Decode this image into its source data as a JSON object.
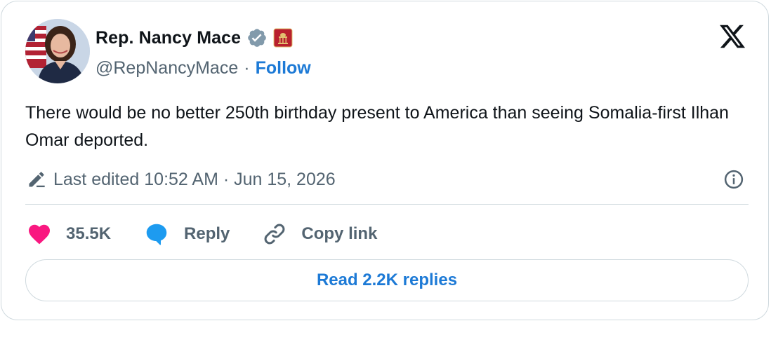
{
  "author": {
    "display_name": "Rep. Nancy Mace",
    "handle": "@RepNancyMace",
    "separator": "·",
    "follow_label": "Follow",
    "verified_badge_color": "#829aab"
  },
  "tweet": {
    "text": "There would be no better 250th birthday present to America than seeing Somalia-first Ilhan Omar deported.",
    "edited_label": "Last edited 10:52 AM · Jun 15, 2026"
  },
  "actions": {
    "like_count": "35.5K",
    "reply_label": "Reply",
    "copy_label": "Copy link",
    "read_replies_label": "Read 2.2K replies"
  },
  "colors": {
    "accent": "#1d7ad6",
    "like": "#f91880",
    "secondary_text": "#536471",
    "border": "#cfd9de"
  },
  "icons": [
    "avatar-photo",
    "verified-badge-icon",
    "congress-affiliation-icon",
    "x-logo-icon",
    "edit-pencil-icon",
    "info-icon",
    "heart-icon",
    "reply-bubble-icon",
    "link-icon"
  ]
}
